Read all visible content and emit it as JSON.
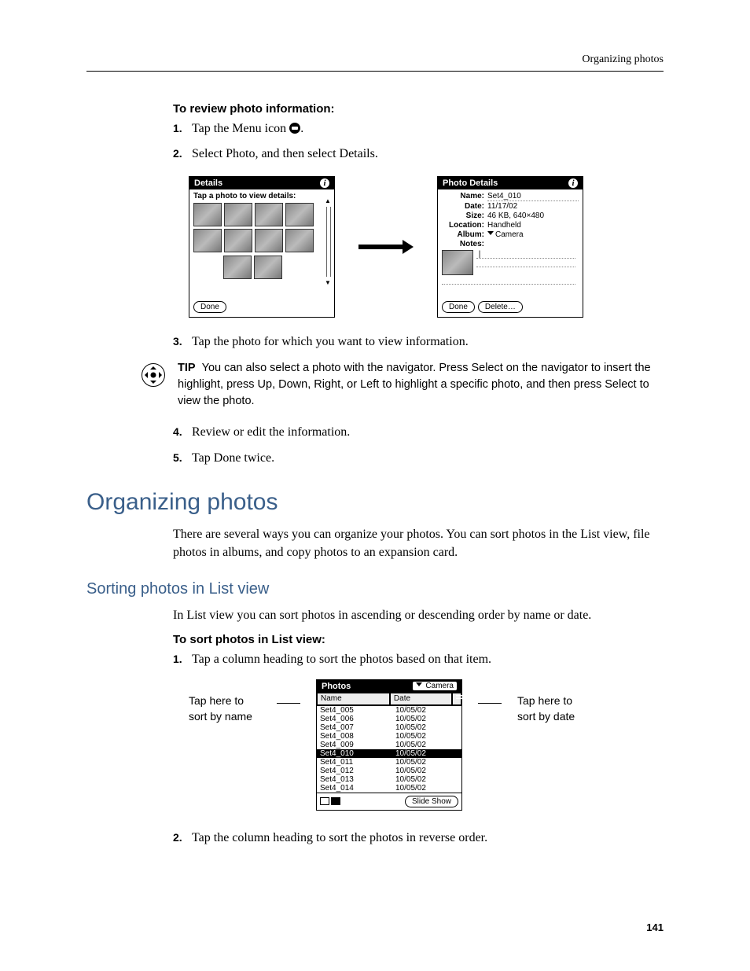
{
  "header": {
    "section": "Organizing photos"
  },
  "review": {
    "heading": "To review photo information:",
    "steps": {
      "s1_num": "1.",
      "s1_text": "Tap the Menu icon ",
      "s1_text_after": ".",
      "s2_num": "2.",
      "s2_text": "Select Photo, and then select Details.",
      "s3_num": "3.",
      "s3_text": "Tap the photo for which you want to view information.",
      "s4_num": "4.",
      "s4_text": "Review or edit the information.",
      "s5_num": "5.",
      "s5_text": "Tap Done twice."
    }
  },
  "screens": {
    "details_title": "Details",
    "details_sub": "Tap a photo to view details:",
    "done_btn": "Done",
    "photo_title": "Photo Details",
    "name_label": "Name:",
    "name_val": "Set4_010",
    "date_label": "Date:",
    "date_val": "11/17/02",
    "size_label": "Size:",
    "size_val": "46 KB, 640×480",
    "loc_label": "Location:",
    "loc_val": "Handheld",
    "album_label": "Album:",
    "album_val": "Camera",
    "notes_label": "Notes:",
    "delete_btn": "Delete…"
  },
  "tip": {
    "label": "TIP",
    "text": "You can also select a photo with the navigator. Press Select on the navigator to insert the highlight, press Up, Down, Right, or Left to highlight a specific photo, and then press Select to view the photo."
  },
  "organizing": {
    "title": "Organizing photos",
    "para": "There are several ways you can organize your photos. You can sort photos in the List view, file photos in albums, and copy photos to an expansion card."
  },
  "sorting": {
    "title": "Sorting photos in List view",
    "para": "In List view you can sort photos in ascending or descending order by name or date.",
    "proc_heading": "To sort photos in List view:",
    "s1_num": "1.",
    "s1_text": "Tap a column heading to sort the photos based on that item.",
    "s2_num": "2.",
    "s2_text": "Tap the column heading to sort the photos in reverse order."
  },
  "list_screen": {
    "title": "Photos",
    "dropdown": "Camera",
    "name_col": "Name",
    "date_col": "Date",
    "rows": [
      {
        "n": "Set4_005",
        "d": "10/05/02"
      },
      {
        "n": "Set4_006",
        "d": "10/05/02"
      },
      {
        "n": "Set4_007",
        "d": "10/05/02"
      },
      {
        "n": "Set4_008",
        "d": "10/05/02"
      },
      {
        "n": "Set4_009",
        "d": "10/05/02"
      },
      {
        "n": "Set4_010",
        "d": "10/05/02"
      },
      {
        "n": "Set4_011",
        "d": "10/05/02"
      },
      {
        "n": "Set4_012",
        "d": "10/05/02"
      },
      {
        "n": "Set4_013",
        "d": "10/05/02"
      },
      {
        "n": "Set4_014",
        "d": "10/05/02"
      }
    ],
    "slideshow": "Slide Show"
  },
  "callouts": {
    "left_l1": "Tap here to",
    "left_l2": "sort by name",
    "right_l1": "Tap here to",
    "right_l2": "sort by date"
  },
  "page_number": "141"
}
